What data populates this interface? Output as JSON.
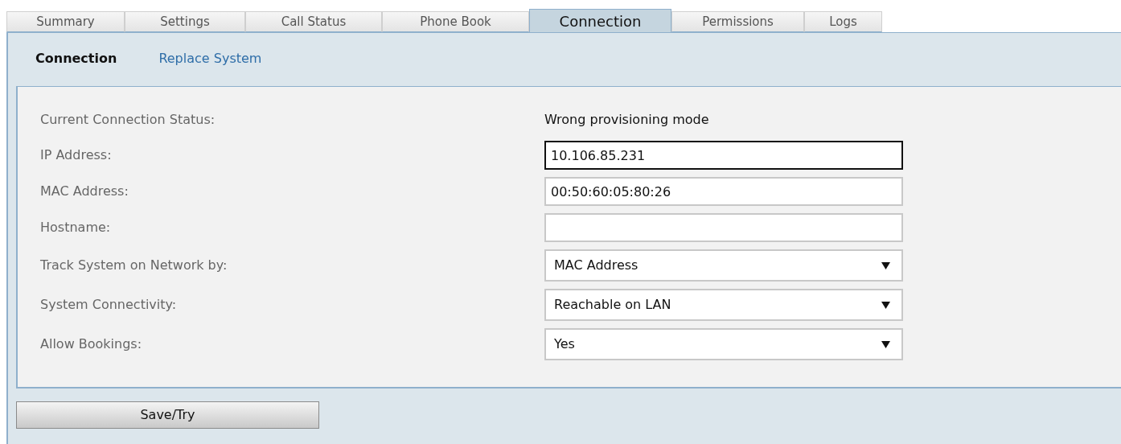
{
  "tabs": [
    {
      "label": "Summary",
      "selected": false
    },
    {
      "label": "Settings",
      "selected": false
    },
    {
      "label": "Call Status",
      "selected": false
    },
    {
      "label": "Phone Book",
      "selected": false
    },
    {
      "label": "Connection",
      "selected": true
    },
    {
      "label": "Permissions",
      "selected": false
    },
    {
      "label": "Logs",
      "selected": false
    }
  ],
  "sub_tabs": [
    {
      "label": "Connection",
      "selected": true
    },
    {
      "label": "Replace System",
      "selected": false
    }
  ],
  "fields": [
    {
      "kind": "static",
      "label": "Current Connection Status:",
      "value": "Wrong provisioning mode"
    },
    {
      "kind": "text",
      "label": "IP Address:",
      "value": "10.106.85.231",
      "focused": true
    },
    {
      "kind": "text",
      "label": "MAC Address:",
      "value": "00:50:60:05:80:26",
      "focused": false
    },
    {
      "kind": "text",
      "label": "Hostname:",
      "focused": false
    },
    {
      "kind": "select",
      "label": "Track System on Network by:",
      "value": "MAC Address"
    },
    {
      "kind": "select",
      "label": "System Connectivity:",
      "value": "Reachable on LAN"
    },
    {
      "kind": "select",
      "label": "Allow Bookings:",
      "value": "Yes"
    }
  ],
  "save_button": "Save/Try"
}
